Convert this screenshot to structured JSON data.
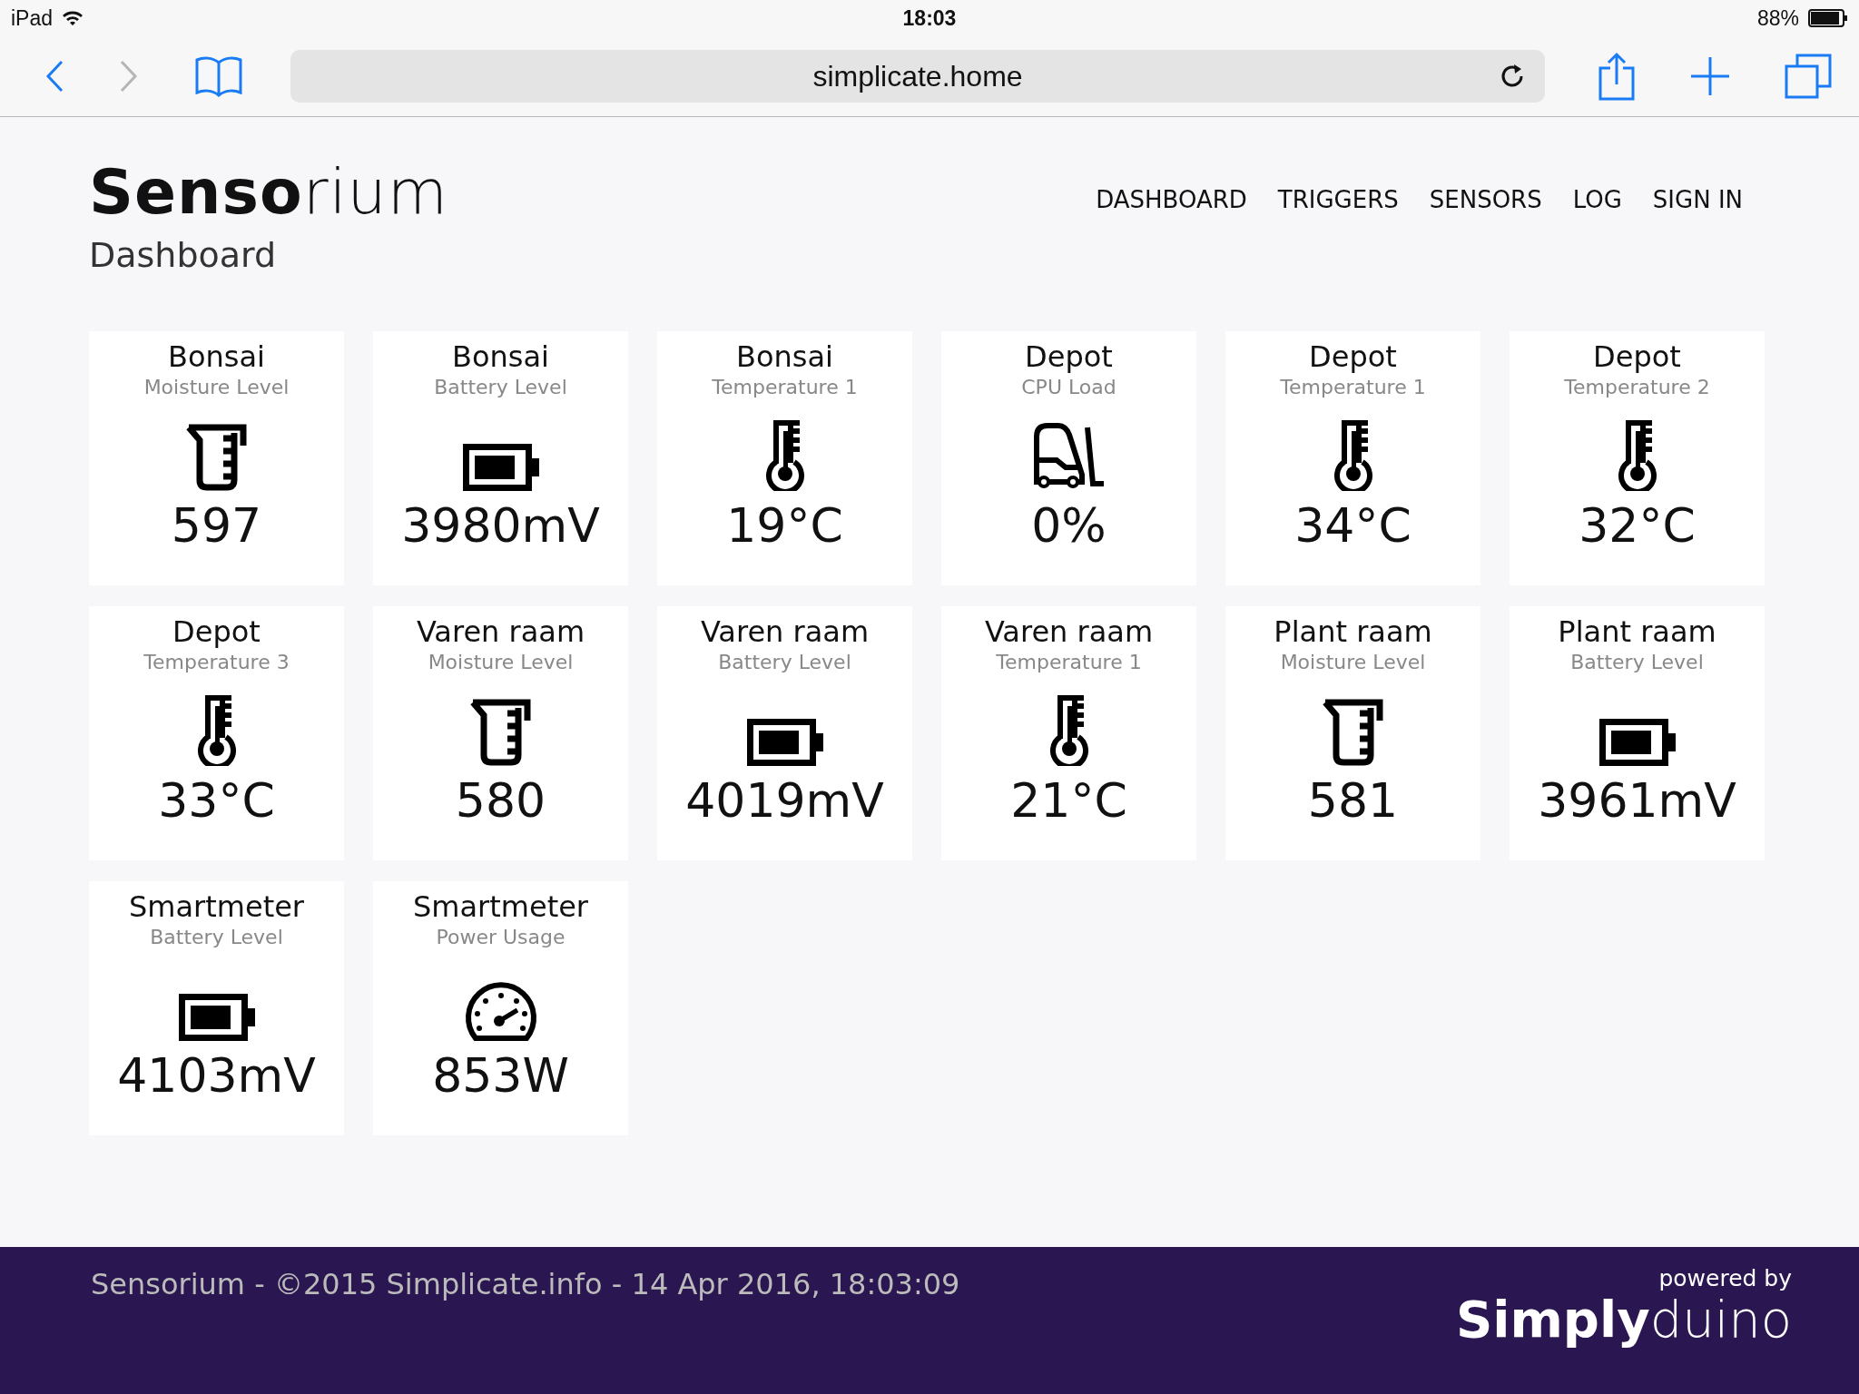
{
  "status_bar": {
    "device": "iPad",
    "time": "18:03",
    "battery": "88%"
  },
  "browser": {
    "url": "simplicate.home"
  },
  "header": {
    "logo": "**Senso**rium",
    "nav": [
      "DASHBOARD",
      "TRIGGERS",
      "SENSORS",
      "LOG",
      "SIGN IN"
    ],
    "page_title": "Dashboard"
  },
  "sensors": [
    {
      "device": "Bonsai",
      "metric": "Moisture Level",
      "kind": "moisture",
      "value": "597"
    },
    {
      "device": "Bonsai",
      "metric": "Battery Level",
      "kind": "battery",
      "value": "3980mV"
    },
    {
      "device": "Bonsai",
      "metric": "Temperature 1",
      "kind": "temperature",
      "value": "19°C"
    },
    {
      "device": "Depot",
      "metric": "CPU Load",
      "kind": "cpu",
      "value": "0%"
    },
    {
      "device": "Depot",
      "metric": "Temperature 1",
      "kind": "temperature",
      "value": "34°C"
    },
    {
      "device": "Depot",
      "metric": "Temperature 2",
      "kind": "temperature",
      "value": "32°C"
    },
    {
      "device": "Depot",
      "metric": "Temperature 3",
      "kind": "temperature",
      "value": "33°C"
    },
    {
      "device": "Varen raam",
      "metric": "Moisture Level",
      "kind": "moisture",
      "value": "580"
    },
    {
      "device": "Varen raam",
      "metric": "Battery Level",
      "kind": "battery",
      "value": "4019mV"
    },
    {
      "device": "Varen raam",
      "metric": "Temperature 1",
      "kind": "temperature",
      "value": "21°C"
    },
    {
      "device": "Plant raam",
      "metric": "Moisture Level",
      "kind": "moisture",
      "value": "581"
    },
    {
      "device": "Plant raam",
      "metric": "Battery Level",
      "kind": "battery",
      "value": "3961mV"
    },
    {
      "device": "Smartmeter",
      "metric": "Battery Level",
      "kind": "battery",
      "value": "4103mV"
    },
    {
      "device": "Smartmeter",
      "metric": "Power Usage",
      "kind": "power",
      "value": "853W"
    }
  ],
  "footer": {
    "text": "Sensorium - ©2015 Simplicate.info - 14 Apr 2016, 18:03:09",
    "powered_by": "powered by",
    "brand": "**Simply**duino"
  }
}
